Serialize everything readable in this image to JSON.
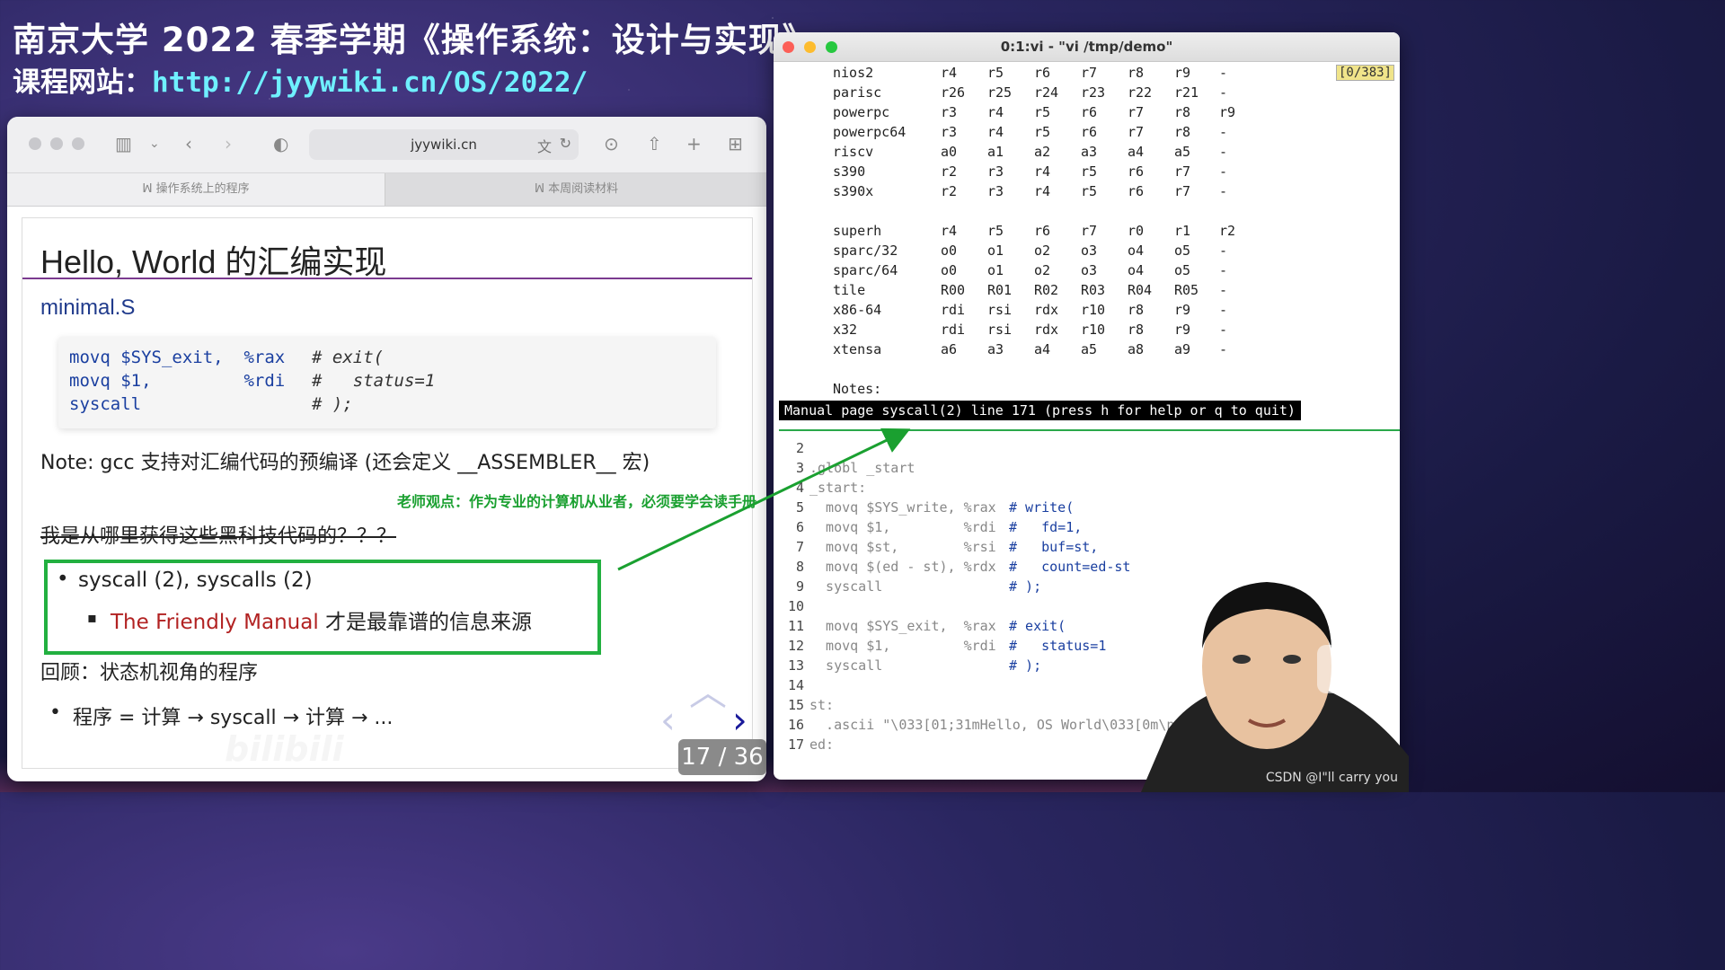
{
  "header": {
    "title": "南京大学 2022 春季学期《操作系统：设计与实现》",
    "site_label": "课程网站：",
    "site_url": "http://jyywiki.cn/OS/2022/"
  },
  "browser": {
    "address": "jyywiki.cn",
    "tabs": [
      "操作系统上的程序",
      "本周阅读材料"
    ]
  },
  "slide": {
    "title": "Hello, World 的汇编实现",
    "file": "minimal.S",
    "code": [
      {
        "text": "movq $SYS_exit,  %rax",
        "comment": "# exit("
      },
      {
        "text": "movq $1,         %rdi",
        "comment": "#   status=1"
      },
      {
        "text": "syscall",
        "comment": "# );"
      }
    ],
    "note": "Note: gcc 支持对汇编代码的预编译 (还会定义 __ASSEMBLER__ 宏)",
    "question": "我是从哪里获得这些黑科技代码的？？？",
    "bullet1": "syscall (2), syscalls (2)",
    "bullet2_red": "The Friendly Manual",
    "bullet2_rest": " 才是最靠谱的信息来源",
    "review": "回顾：状态机视角的程序",
    "program": "程序 = 计算 → syscall → 计算 → ...",
    "pager": "17 / 36"
  },
  "annotation": "老师观点：作为专业的计算机从业者，必须要学会读手册",
  "terminal": {
    "title": "0:1:vi - \"vi /tmp/demo\"",
    "position": "[0/383]",
    "man_rows": [
      [
        "nios2",
        "r4",
        "r5",
        "r6",
        "r7",
        "r8",
        "r9",
        "-"
      ],
      [
        "parisc",
        "r26",
        "r25",
        "r24",
        "r23",
        "r22",
        "r21",
        "-"
      ],
      [
        "powerpc",
        "r3",
        "r4",
        "r5",
        "r6",
        "r7",
        "r8",
        "r9"
      ],
      [
        "powerpc64",
        "r3",
        "r4",
        "r5",
        "r6",
        "r7",
        "r8",
        "-"
      ],
      [
        "riscv",
        "a0",
        "a1",
        "a2",
        "a3",
        "a4",
        "a5",
        "-"
      ],
      [
        "s390",
        "r2",
        "r3",
        "r4",
        "r5",
        "r6",
        "r7",
        "-"
      ],
      [
        "s390x",
        "r2",
        "r3",
        "r4",
        "r5",
        "r6",
        "r7",
        "-"
      ],
      [
        "",
        "",
        "",
        "",
        "",
        "",
        "",
        ""
      ],
      [
        "superh",
        "r4",
        "r5",
        "r6",
        "r7",
        "r0",
        "r1",
        "r2"
      ],
      [
        "sparc/32",
        "o0",
        "o1",
        "o2",
        "o3",
        "o4",
        "o5",
        "-"
      ],
      [
        "sparc/64",
        "o0",
        "o1",
        "o2",
        "o3",
        "o4",
        "o5",
        "-"
      ],
      [
        "tile",
        "R00",
        "R01",
        "R02",
        "R03",
        "R04",
        "R05",
        "-"
      ],
      [
        "x86-64",
        "rdi",
        "rsi",
        "rdx",
        "r10",
        "r8",
        "r9",
        "-"
      ],
      [
        "x32",
        "rdi",
        "rsi",
        "rdx",
        "r10",
        "r8",
        "r9",
        "-"
      ],
      [
        "xtensa",
        "a6",
        "a3",
        "a4",
        "a5",
        "a8",
        "a9",
        "-"
      ],
      [
        "",
        "",
        "",
        "",
        "",
        "",
        "",
        ""
      ],
      [
        "Notes:",
        "",
        "",
        "",
        "",
        "",
        "",
        ""
      ]
    ],
    "status": "Manual page syscall(2) line 171 (press h for help or q to quit)",
    "vi_lines": [
      {
        "n": "2",
        "t": ""
      },
      {
        "n": "3",
        "t": ".globl _start"
      },
      {
        "n": "4",
        "t": "_start:"
      },
      {
        "n": "5",
        "t": "  movq $SYS_write, %rax",
        "c": "# write("
      },
      {
        "n": "6",
        "t": "  movq $1,         %rdi",
        "c": "#   fd=1,"
      },
      {
        "n": "7",
        "t": "  movq $st,        %rsi",
        "c": "#   buf=st,"
      },
      {
        "n": "8",
        "t": "  movq $(ed - st), %rdx",
        "c": "#   count=ed-st"
      },
      {
        "n": "9",
        "t": "  syscall",
        "c": "# );"
      },
      {
        "n": "10",
        "t": ""
      },
      {
        "n": "11",
        "t": "  movq $SYS_exit,  %rax",
        "c": "# exit("
      },
      {
        "n": "12",
        "t": "  movq $1,         %rdi",
        "c": "#   status=1"
      },
      {
        "n": "13",
        "t": "  syscall",
        "c": "# );"
      },
      {
        "n": "14",
        "t": ""
      },
      {
        "n": "15",
        "t": "st:"
      },
      {
        "n": "16",
        "t": "  .ascii \"\\033[01;31mHello, OS World\\033[0m\\n\""
      },
      {
        "n": "17",
        "t": "ed:"
      }
    ]
  },
  "watermark": "CSDN @I\"ll  carry  you",
  "bili_logo": "bilibili"
}
